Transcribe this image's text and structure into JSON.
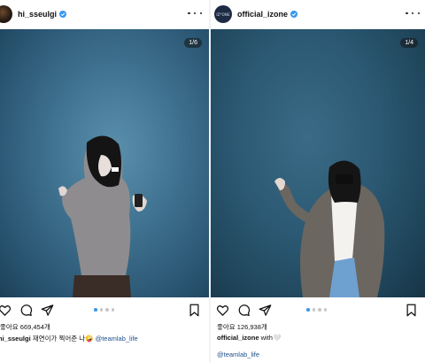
{
  "post_left": {
    "username": "hi_sseulgi",
    "image_counter": "1/6",
    "likes": "좋아요 669,454개",
    "caption_user": "hi_sseulgi",
    "caption_text": " 재연이가 찍어준 나",
    "caption_emoji": "🤪",
    "caption_mention": "@teamlab_life",
    "carousel_count": 4,
    "carousel_active": 0
  },
  "post_right": {
    "username": "official_izone",
    "avatar_text": "IZ*ONE",
    "image_counter": "1/4",
    "likes": "좋아요 126,938개",
    "caption_user": "official_izone",
    "caption_text": " with",
    "caption_emoji": "🤍",
    "caption_mention": "@teamlab_life",
    "carousel_count": 4,
    "carousel_active": 0
  },
  "colors": {
    "verified": "#3897f0",
    "mention": "#1f4e8c",
    "carousel_active": "#3897f0"
  },
  "icons": [
    "heart-icon",
    "comment-icon",
    "share-icon",
    "bookmark-icon",
    "more-icon",
    "verified-icon"
  ]
}
